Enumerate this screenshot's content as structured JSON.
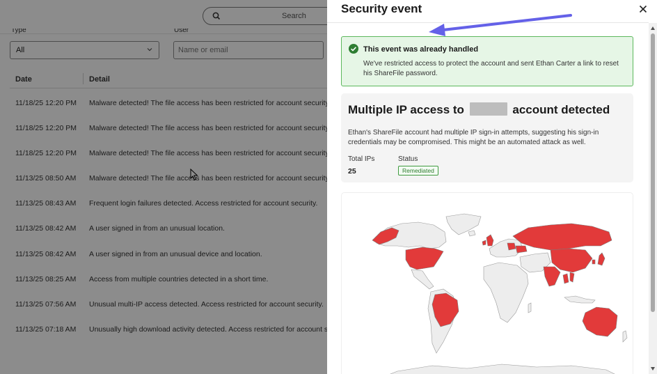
{
  "search": {
    "placeholder": "Search"
  },
  "filters": {
    "type_label": "Type",
    "type_value": "All",
    "user_label": "User",
    "user_placeholder": "Name or email"
  },
  "table": {
    "columns": [
      "Date",
      "Detail"
    ],
    "rows": [
      {
        "date": "11/18/25 12:20 PM",
        "detail": "Malware detected! The file access has been restricted for account security."
      },
      {
        "date": "11/18/25 12:20 PM",
        "detail": "Malware detected! The file access has been restricted for account security."
      },
      {
        "date": "11/18/25 12:20 PM",
        "detail": "Malware detected! The file access has been restricted for account security."
      },
      {
        "date": "11/13/25 08:50 AM",
        "detail": "Malware detected! The file access has been restricted for account security."
      },
      {
        "date": "11/13/25 08:43 AM",
        "detail": "Frequent login failures detected. Access restricted for account security."
      },
      {
        "date": "11/13/25 08:42 AM",
        "detail": "A user signed in from an unusual location."
      },
      {
        "date": "11/13/25 08:42 AM",
        "detail": "A user signed in from an unusual device and location."
      },
      {
        "date": "11/13/25 08:25 AM",
        "detail": "Access from multiple countries detected in a short time."
      },
      {
        "date": "11/13/25 07:56 AM",
        "detail": "Unusual multi-IP access detected. Access restricted for account security."
      },
      {
        "date": "11/13/25 07:18 AM",
        "detail": "Unusually high download activity detected. Access restricted for account security."
      }
    ]
  },
  "panel": {
    "title": "Security event",
    "handled": {
      "heading": "This event was already handled",
      "body": "We've restricted access to protect the account and sent Ethan Carter a link to reset his ShareFile password."
    },
    "event": {
      "title_prefix": "Multiple IP access to",
      "title_suffix": "account detected",
      "description": "Ethan's ShareFile account had multiple IP sign-in attempts, suggesting his sign-in credentials may be compromised. This might be an automated attack as well.",
      "total_ips_label": "Total IPs",
      "total_ips_value": "25",
      "status_label": "Status",
      "status_value": "Remediated"
    },
    "map": {
      "highlighted_regions": [
        "United States",
        "Brazil",
        "United Kingdom",
        "Ireland",
        "Poland",
        "Ukraine",
        "Russia",
        "China",
        "India",
        "Thailand",
        "Vietnam",
        "Japan",
        "South Korea",
        "Australia"
      ]
    }
  },
  "colors": {
    "highlight_red": "#e23a3a",
    "success_green": "#5cb85c",
    "arrow_purple": "#6461e8"
  },
  "icons": {
    "search": "search-icon",
    "close": "close-icon",
    "check": "check-circle-icon",
    "chevron": "chevron-down-icon"
  }
}
